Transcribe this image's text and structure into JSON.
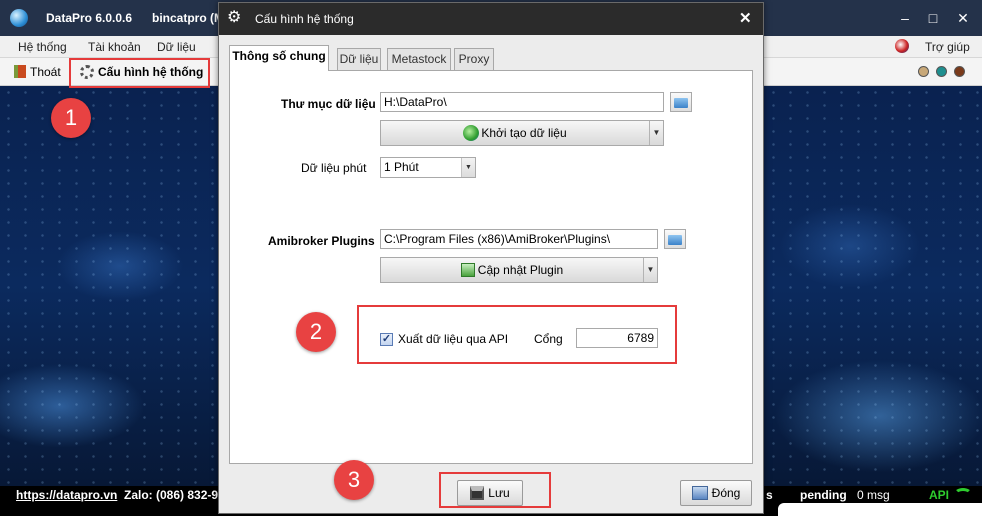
{
  "app": {
    "name": "DataPro 6.0.0.6",
    "user": "bincatpro (M",
    "menu": {
      "he_thong": "Hệ thống",
      "tai_khoan": "Tài khoản",
      "du_lieu": "Dữ liệu",
      "tro_giup": "Trợ giúp"
    },
    "toolbar": {
      "thoat": "Thoát",
      "cau_hinh": "Cấu hình hệ thống"
    },
    "status": {
      "link": "https://datapro.vn",
      "zalo": "Zalo: (086) 832-9",
      "partial": "s",
      "pending": "pending",
      "msg_count": "0 msg",
      "api": "API"
    },
    "window_controls": {
      "minimize": "–",
      "maximize": "□",
      "close": "✕"
    },
    "status_dot_colors": [
      "#c8a878",
      "#1f8f8f",
      "#7a3a1a"
    ]
  },
  "dialog": {
    "title": "Cấu hình hệ thống",
    "close_glyph": "✕",
    "tabs": [
      "Thông số chung",
      "Dữ liệu",
      "Metastock",
      "Proxy"
    ],
    "active_tab": "Thông số chung",
    "data_folder": {
      "label": "Thư mục dữ liệu",
      "value": "H:\\DataPro\\"
    },
    "init_button": "Khởi tạo dữ liệu",
    "minute_data": {
      "label": "Dữ liệu phút",
      "value": "1 Phút"
    },
    "amibroker": {
      "label": "Amibroker Plugins",
      "value": "C:\\Program Files (x86)\\AmiBroker\\Plugins\\"
    },
    "update_plugin_button": "Cập nhật Plugin",
    "api_export": {
      "label": "Xuất dữ liệu qua API",
      "checked": true,
      "port_label": "Cổng",
      "port_value": "6789"
    },
    "save_button": "Lưu",
    "close_button": "Đóng"
  },
  "annotations": {
    "step1": "1",
    "step2": "2",
    "step3": "3",
    "highlight_color": "#e53b3b"
  }
}
